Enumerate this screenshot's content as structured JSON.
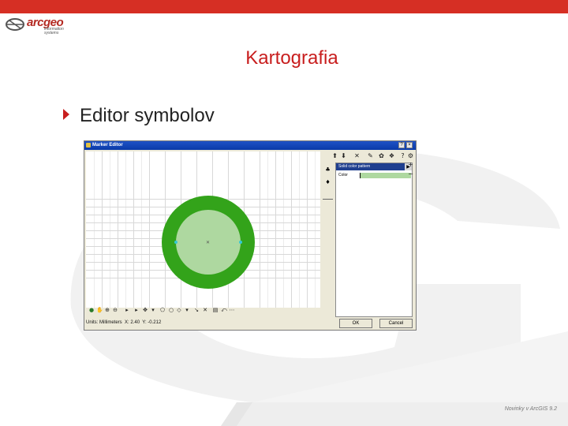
{
  "slide": {
    "title": "Kartografia",
    "bullet": "Editor symbolov",
    "footer": "Novinky v ArcGIS 9.2",
    "accent_color": "#c81e1e"
  },
  "logo": {
    "word": "arcgeo",
    "subtitle": "information systems"
  },
  "window": {
    "title": "Marker Editor",
    "icon": "app-icon",
    "controls": [
      "?",
      "×"
    ]
  },
  "symbol": {
    "outer_color": "#33a31a",
    "fill_color": "#aed8a0"
  },
  "properties": {
    "header": "Solid color pattern",
    "color_label": "Color"
  },
  "status": {
    "units_label": "Units: Millimeters",
    "x_label": "X:",
    "x_value": "2.40",
    "y_label": "Y:",
    "y_value": "-0.212"
  },
  "buttons": {
    "ok": "OK",
    "cancel": "Cancel"
  },
  "icons": {
    "toolbar": [
      "move-up-icon",
      "move-down-icon",
      "delete-icon",
      "edit-icon",
      "color-icon",
      "paint-icon",
      "help-icon"
    ],
    "layer": [
      "add-layer-icon",
      "layer-option-icon"
    ],
    "drawing": [
      "globe-icon",
      "pan-icon",
      "zoom-icon",
      "zoom-out-icon",
      "select-icon",
      "point-icon",
      "node-icon",
      "polygon-icon",
      "ellipse-icon",
      "line-icon",
      "delete-tool-icon",
      "frame-icon",
      "text-icon"
    ]
  }
}
